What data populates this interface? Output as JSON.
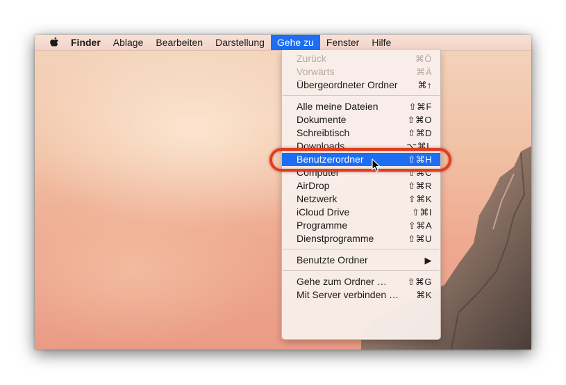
{
  "menubar": {
    "apple_icon": "apple-logo-icon",
    "items": [
      {
        "label": "Finder"
      },
      {
        "label": "Ablage"
      },
      {
        "label": "Bearbeiten"
      },
      {
        "label": "Darstellung"
      },
      {
        "label": "Gehe zu"
      },
      {
        "label": "Fenster"
      },
      {
        "label": "Hilfe"
      }
    ]
  },
  "menu": {
    "groups": [
      [
        {
          "label": "Zurück",
          "shortcut": "⌘Ö",
          "disabled": true
        },
        {
          "label": "Vorwärts",
          "shortcut": "⌘Ä",
          "disabled": true
        },
        {
          "label": "Übergeordneter Ordner",
          "shortcut": "⌘↑"
        }
      ],
      [
        {
          "label": "Alle meine Dateien",
          "shortcut": "⇧⌘F"
        },
        {
          "label": "Dokumente",
          "shortcut": "⇧⌘O"
        },
        {
          "label": "Schreibtisch",
          "shortcut": "⇧⌘D"
        },
        {
          "label": "Downloads",
          "shortcut": "⌥⌘L"
        },
        {
          "label": "Benutzerordner",
          "shortcut": "⇧⌘H",
          "highlighted": true
        },
        {
          "label": "Computer",
          "shortcut": "⇧⌘C"
        },
        {
          "label": "AirDrop",
          "shortcut": "⇧⌘R"
        },
        {
          "label": "Netzwerk",
          "shortcut": "⇧⌘K"
        },
        {
          "label": "iCloud Drive",
          "shortcut": "⇧⌘I"
        },
        {
          "label": "Programme",
          "shortcut": "⇧⌘A"
        },
        {
          "label": "Dienstprogramme",
          "shortcut": "⇧⌘U"
        }
      ],
      [
        {
          "label": "Benutzte Ordner",
          "shortcut": "▶"
        }
      ],
      [
        {
          "label": "Gehe zum Ordner …",
          "shortcut": "⇧⌘G"
        },
        {
          "label": "Mit Server verbinden …",
          "shortcut": "⌘K"
        }
      ]
    ]
  },
  "colors": {
    "selection": "#1d6ef2",
    "annotation_ring": "#e23b1f"
  }
}
